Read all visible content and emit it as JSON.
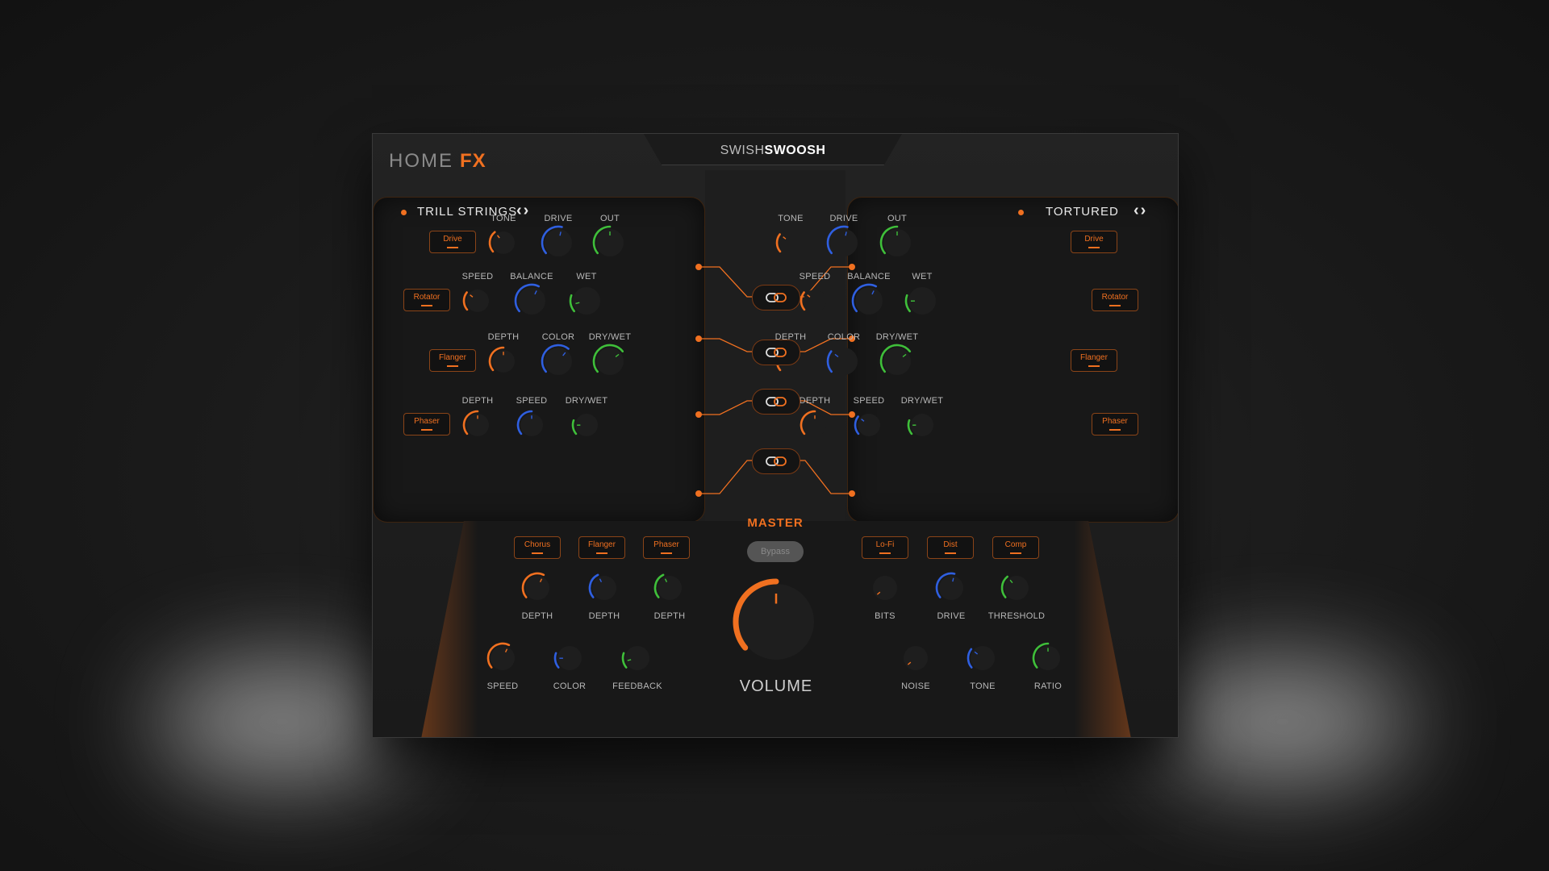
{
  "header": {
    "logo_home": "HOME",
    "logo_fx": "FX",
    "brand_a": "SWISH",
    "brand_b": "SWOOSH"
  },
  "colors": {
    "orange": "#f07020",
    "blue": "#2f5fe0",
    "green": "#3fbf3a",
    "track": "#2a2a2a"
  },
  "left_chain": {
    "title": "TRILL STRINGS",
    "arrows": "‹›",
    "rows": [
      {
        "module": "Drive",
        "knobs": [
          {
            "label": "TONE",
            "color": "orange",
            "value": 0.35
          },
          {
            "label": "DRIVE",
            "color": "blue",
            "value": 0.55
          },
          {
            "label": "OUT",
            "color": "green",
            "value": 0.5
          }
        ]
      },
      {
        "module": "Rotator",
        "knobs": [
          {
            "label": "SPEED",
            "color": "orange",
            "value": 0.3
          },
          {
            "label": "BALANCE",
            "color": "blue",
            "value": 0.6
          },
          {
            "label": "WET",
            "color": "green",
            "value": 0.1
          }
        ]
      },
      {
        "module": "Flanger",
        "knobs": [
          {
            "label": "DEPTH",
            "color": "orange",
            "value": 0.5
          },
          {
            "label": "COLOR",
            "color": "blue",
            "value": 0.65
          },
          {
            "label": "DRY/WET",
            "color": "green",
            "value": 0.7
          }
        ]
      },
      {
        "module": "Phaser",
        "knobs": [
          {
            "label": "DEPTH",
            "color": "orange",
            "value": 0.5
          },
          {
            "label": "SPEED",
            "color": "blue",
            "value": 0.5
          },
          {
            "label": "DRY/WET",
            "color": "green",
            "value": 0.15
          }
        ]
      }
    ]
  },
  "right_chain": {
    "title": "TORTURED",
    "arrows": "‹›",
    "rows": [
      {
        "module": "Drive",
        "knobs": [
          {
            "label": "TONE",
            "color": "orange",
            "value": 0.3
          },
          {
            "label": "DRIVE",
            "color": "blue",
            "value": 0.55
          },
          {
            "label": "OUT",
            "color": "green",
            "value": 0.5
          }
        ]
      },
      {
        "module": "Rotator",
        "knobs": [
          {
            "label": "SPEED",
            "color": "orange",
            "value": 0.3
          },
          {
            "label": "BALANCE",
            "color": "blue",
            "value": 0.6
          },
          {
            "label": "WET",
            "color": "green",
            "value": 0.15
          }
        ]
      },
      {
        "module": "Flanger",
        "knobs": [
          {
            "label": "DEPTH",
            "color": "orange",
            "value": 0.5
          },
          {
            "label": "COLOR",
            "color": "blue",
            "value": 0.3
          },
          {
            "label": "DRY/WET",
            "color": "green",
            "value": 0.7
          }
        ]
      },
      {
        "module": "Phaser",
        "knobs": [
          {
            "label": "DEPTH",
            "color": "orange",
            "value": 0.5
          },
          {
            "label": "SPEED",
            "color": "blue",
            "value": 0.3
          },
          {
            "label": "DRY/WET",
            "color": "green",
            "value": 0.15
          }
        ]
      }
    ]
  },
  "master": {
    "title": "MASTER",
    "bypass": "Bypass",
    "volume_label": "VOLUME",
    "volume_value": 0.5,
    "left_modules": [
      "Chorus",
      "Flanger",
      "Phaser"
    ],
    "right_modules": [
      "Lo-Fi",
      "Dist",
      "Comp"
    ],
    "left_knobs_row1": [
      {
        "label": "DEPTH",
        "color": "orange",
        "value": 0.6
      },
      {
        "label": "DEPTH",
        "color": "blue",
        "value": 0.4
      },
      {
        "label": "DEPTH",
        "color": "green",
        "value": 0.4
      }
    ],
    "left_knobs_row2": [
      {
        "label": "SPEED",
        "color": "orange",
        "value": 0.6
      },
      {
        "label": "COLOR",
        "color": "blue",
        "value": 0.15
      },
      {
        "label": "FEEDBACK",
        "color": "green",
        "value": 0.1
      }
    ],
    "right_knobs_row1": [
      {
        "label": "BITS",
        "color": "orange",
        "value": 0.0
      },
      {
        "label": "DRIVE",
        "color": "blue",
        "value": 0.55
      },
      {
        "label": "THRESHOLD",
        "color": "green",
        "value": 0.35
      }
    ],
    "right_knobs_row2": [
      {
        "label": "NOISE",
        "color": "orange",
        "value": 0.0
      },
      {
        "label": "TONE",
        "color": "blue",
        "value": 0.3
      },
      {
        "label": "RATIO",
        "color": "green",
        "value": 0.5
      }
    ]
  }
}
